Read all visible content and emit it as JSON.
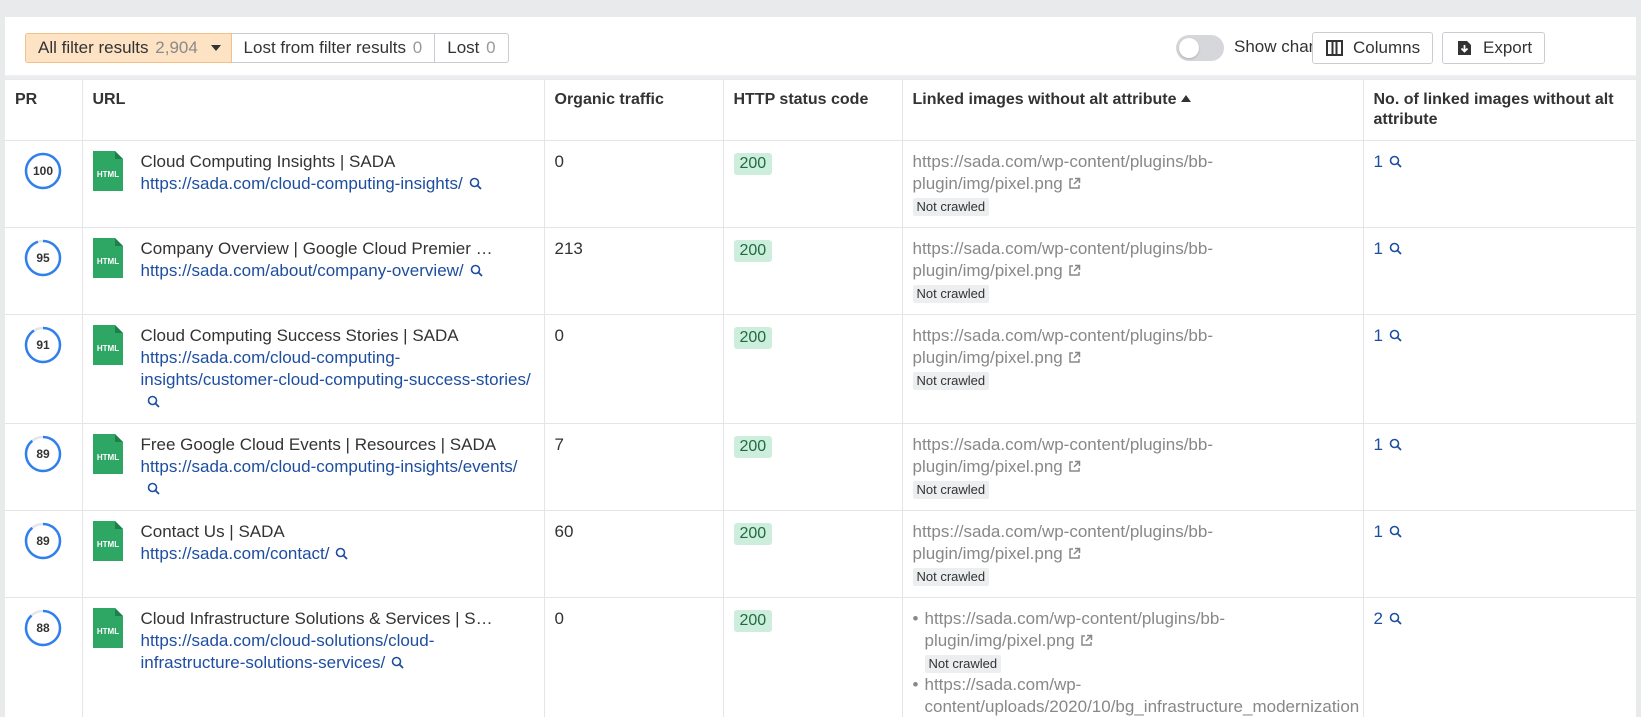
{
  "filters": {
    "all_label": "All filter results",
    "all_count": "2,904",
    "lost_label": "Lost from filter results",
    "lost_count": "0",
    "lost2_label": "Lost",
    "lost2_count": "0"
  },
  "tools": {
    "show_changes_label": "Show changes",
    "help_glyph": "?",
    "columns_label": "Columns",
    "export_label": "Export"
  },
  "columns": {
    "pr": "PR",
    "url": "URL",
    "organic": "Organic traffic",
    "http": "HTTP status code",
    "linked_images": "Linked images without alt attribute",
    "count": "No. of linked images without alt attribute"
  },
  "html_icon_text": "HTML",
  "not_crawled_label": "Not crawled",
  "rows": [
    {
      "pr": "100",
      "pr_fill": 1.0,
      "title": "Cloud Computing Insights | SADA",
      "url": "https://sada.com/cloud-computing-insights/",
      "traffic": "0",
      "status": "200",
      "images": [
        "https://sada.com/wp-content/plugins/bb-plugin/img/pixel.png"
      ],
      "count": "1"
    },
    {
      "pr": "95",
      "pr_fill": 0.95,
      "title": "Company Overview | Google Cloud Premier …",
      "url": "https://sada.com/about/company-overview/",
      "traffic": "213",
      "status": "200",
      "images": [
        "https://sada.com/wp-content/plugins/bb-plugin/img/pixel.png"
      ],
      "count": "1"
    },
    {
      "pr": "91",
      "pr_fill": 0.91,
      "title": "Cloud Computing Success Stories | SADA",
      "url": "https://sada.com/cloud-computing-insights/customer-cloud-computing-success-stories/",
      "traffic": "0",
      "status": "200",
      "images": [
        "https://sada.com/wp-content/plugins/bb-plugin/img/pixel.png"
      ],
      "count": "1"
    },
    {
      "pr": "89",
      "pr_fill": 0.89,
      "title": "Free Google Cloud Events | Resources | SADA",
      "url": "https://sada.com/cloud-computing-insights/events/",
      "traffic": "7",
      "status": "200",
      "images": [
        "https://sada.com/wp-content/plugins/bb-plugin/img/pixel.png"
      ],
      "count": "1"
    },
    {
      "pr": "89",
      "pr_fill": 0.89,
      "title": "Contact Us | SADA",
      "url": "https://sada.com/contact/",
      "traffic": "60",
      "status": "200",
      "images": [
        "https://sada.com/wp-content/plugins/bb-plugin/img/pixel.png"
      ],
      "count": "1"
    },
    {
      "pr": "88",
      "pr_fill": 0.88,
      "title": "Cloud Infrastructure Solutions & Services | S…",
      "url": "https://sada.com/cloud-solutions/cloud-infrastructure-solutions-services/",
      "traffic": "0",
      "status": "200",
      "images": [
        "https://sada.com/wp-content/plugins/bb-plugin/img/pixel.png",
        "https://sada.com/wp-content/uploads/2020/10/bg_infrastructure_modernization"
      ],
      "count": "2"
    }
  ],
  "colors": {
    "accent_blue": "#1d4ea0",
    "pr_ring": "#2f80ed",
    "status_bg": "#cdeedd",
    "filter_active_bg": "#fde3c3",
    "html_icon_green": "#2ea764"
  },
  "icons": {
    "columns": "columns-icon",
    "export": "export-icon",
    "search": "search-icon",
    "external": "external-link-icon",
    "html_file": "html-file-icon"
  }
}
